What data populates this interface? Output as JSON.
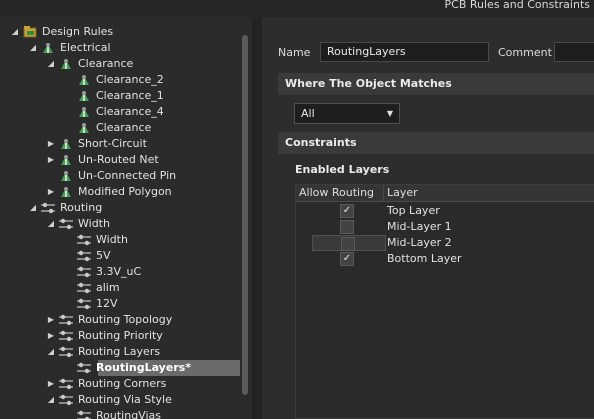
{
  "window": {
    "title": "PCB Rules and Constraints"
  },
  "tree": {
    "rows": [
      {
        "label": "Design Rules",
        "depth": 0,
        "expanded": true,
        "icon": "design-rules-icon",
        "selected": false
      },
      {
        "label": "Electrical",
        "depth": 1,
        "expanded": true,
        "icon": "rule-category-icon",
        "selected": false
      },
      {
        "label": "Clearance",
        "depth": 2,
        "expanded": true,
        "icon": "rule-category-icon",
        "selected": false
      },
      {
        "label": "Clearance_2",
        "depth": 3,
        "expanded": null,
        "icon": "rule-icon",
        "selected": false
      },
      {
        "label": "Clearance_1",
        "depth": 3,
        "expanded": null,
        "icon": "rule-icon",
        "selected": false
      },
      {
        "label": "Clearance_4",
        "depth": 3,
        "expanded": null,
        "icon": "rule-icon",
        "selected": false
      },
      {
        "label": "Clearance",
        "depth": 3,
        "expanded": null,
        "icon": "rule-icon",
        "selected": false
      },
      {
        "label": "Short-Circuit",
        "depth": 2,
        "expanded": false,
        "icon": "rule-category-icon",
        "selected": false
      },
      {
        "label": "Un-Routed Net",
        "depth": 2,
        "expanded": false,
        "icon": "rule-category-icon",
        "selected": false
      },
      {
        "label": "Un-Connected Pin",
        "depth": 2,
        "expanded": null,
        "icon": "rule-category-icon",
        "selected": false
      },
      {
        "label": "Modified Polygon",
        "depth": 2,
        "expanded": false,
        "icon": "rule-category-icon",
        "selected": false
      },
      {
        "label": "Routing",
        "depth": 1,
        "expanded": true,
        "icon": "routing-icon",
        "selected": false
      },
      {
        "label": "Width",
        "depth": 2,
        "expanded": true,
        "icon": "routing-icon",
        "selected": false
      },
      {
        "label": "Width",
        "depth": 3,
        "expanded": null,
        "icon": "routing-icon",
        "selected": false
      },
      {
        "label": "5V",
        "depth": 3,
        "expanded": null,
        "icon": "routing-icon",
        "selected": false
      },
      {
        "label": "3.3V_uC",
        "depth": 3,
        "expanded": null,
        "icon": "routing-icon",
        "selected": false
      },
      {
        "label": "alim",
        "depth": 3,
        "expanded": null,
        "icon": "routing-icon",
        "selected": false
      },
      {
        "label": "12V",
        "depth": 3,
        "expanded": null,
        "icon": "routing-icon",
        "selected": false
      },
      {
        "label": "Routing Topology",
        "depth": 2,
        "expanded": false,
        "icon": "routing-icon",
        "selected": false
      },
      {
        "label": "Routing Priority",
        "depth": 2,
        "expanded": false,
        "icon": "routing-icon",
        "selected": false
      },
      {
        "label": "Routing Layers",
        "depth": 2,
        "expanded": true,
        "icon": "routing-icon",
        "selected": false
      },
      {
        "label": "RoutingLayers*",
        "depth": 3,
        "expanded": null,
        "icon": "routing-icon",
        "selected": true
      },
      {
        "label": "Routing Corners",
        "depth": 2,
        "expanded": false,
        "icon": "routing-icon",
        "selected": false
      },
      {
        "label": "Routing Via Style",
        "depth": 2,
        "expanded": true,
        "icon": "routing-icon",
        "selected": false
      },
      {
        "label": "RoutingVias",
        "depth": 3,
        "expanded": null,
        "icon": "routing-icon",
        "selected": false
      }
    ]
  },
  "rule": {
    "name_label": "Name",
    "name_value": "RoutingLayers",
    "comment_label": "Comment",
    "comment_value": ""
  },
  "where": {
    "header": "Where The Object Matches",
    "scope_value": "All"
  },
  "constraints": {
    "header": "Constraints",
    "enabled_layers_label": "Enabled Layers",
    "col_allow_routing": "Allow Routing",
    "col_layer": "Layer",
    "layers": [
      {
        "name": "Top Layer",
        "checked": true
      },
      {
        "name": "Mid-Layer 1",
        "checked": false
      },
      {
        "name": "Mid-Layer 2",
        "checked": false
      },
      {
        "name": "Bottom Layer",
        "checked": true
      }
    ]
  },
  "colors": {
    "rule_icon_green": "#3fa34d",
    "selected_row": "#6a6a6a"
  }
}
